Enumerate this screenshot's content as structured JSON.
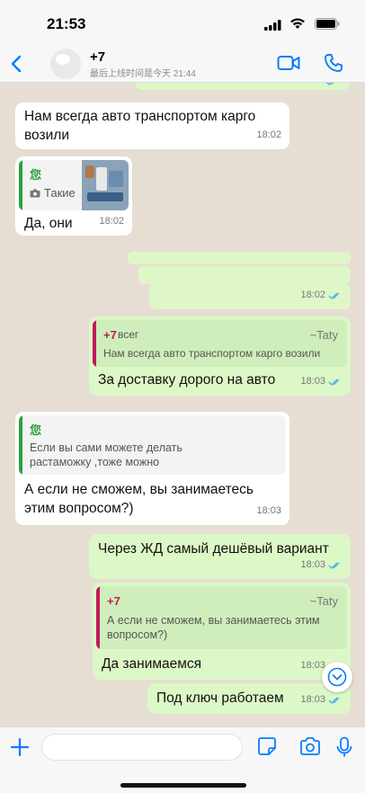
{
  "status_bar": {
    "time": "21:53"
  },
  "header": {
    "contact_name": "+7",
    "contact_status": "最后上线时间是今天 21:44",
    "icons": [
      "back-chevron-icon",
      "video-call-icon",
      "phone-icon"
    ]
  },
  "messages": [
    {
      "dir": "in",
      "text": "Нам всегда авто транспортом карго возили",
      "time": "18:02"
    },
    {
      "dir": "in",
      "reply_author": "您",
      "reply_text": "Такие",
      "reply_has_photo": true,
      "text": "Да, они",
      "time": "18:02"
    },
    {
      "dir": "out",
      "text": "",
      "time": "18:02",
      "read": true
    },
    {
      "dir": "out",
      "reply_author": "+7",
      "reply_author_extra": "всег",
      "reply_alias": "~Taty",
      "reply_text": "Нам всегда авто транспортом карго возили",
      "text": "За доставку дорого на авто",
      "time": "18:03",
      "read": true
    },
    {
      "dir": "in",
      "reply_author": "您",
      "reply_text": "Если вы сами можете делать растаможку ,тоже можно",
      "text": "А если не сможем, вы занимаетесь этим вопросом?)",
      "time": "18:03"
    },
    {
      "dir": "out",
      "text": "Через ЖД самый дешёвый вариант",
      "time": "18:03",
      "read": true
    },
    {
      "dir": "out",
      "reply_author": "+7",
      "reply_alias": "~Taty",
      "reply_text": "А если не сможем, вы занимаетесь этим вопросом?)",
      "text": "Да занимаемся",
      "time": "18:03",
      "read": true
    },
    {
      "dir": "out",
      "text": "Под ключ работаем",
      "time": "18:03",
      "read": true
    }
  ],
  "colors": {
    "incoming": "#ffffff",
    "outgoing": "#dcf8c6",
    "accent": "#0a7cff",
    "self_quote_bar": "#2ea043",
    "other_quote_bar": "#c2185b"
  },
  "composer": {
    "icons": [
      "plus-icon",
      "sticker-icon",
      "camera-icon",
      "microphone-icon"
    ]
  }
}
